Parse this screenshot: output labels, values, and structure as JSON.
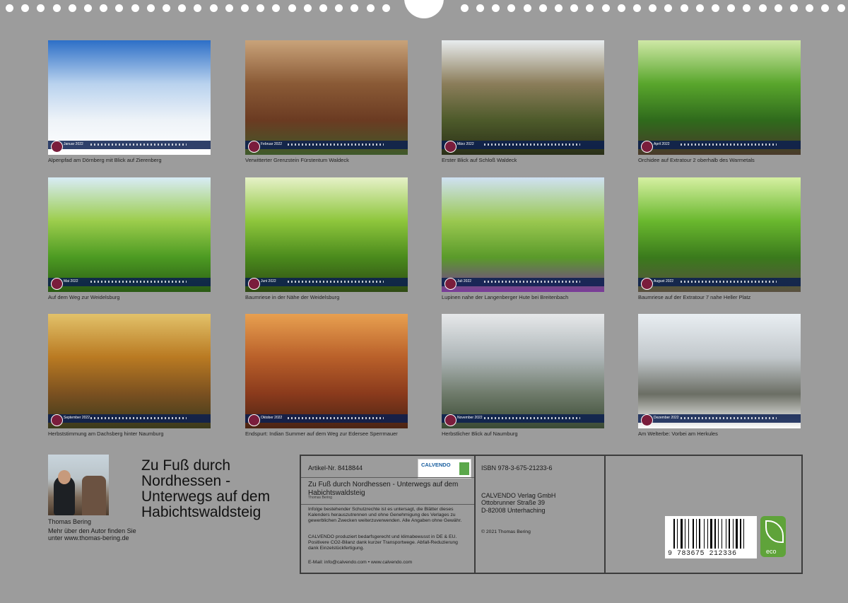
{
  "calendar": {
    "tiles": [
      {
        "caption": "Alpenpfad am Dörnberg mit Blick auf Zierenberg",
        "month_label": "Januar 2022",
        "palette": [
          "#2d6fc7",
          "#b9d2ee",
          "#eef3f8",
          "#ffffff"
        ]
      },
      {
        "caption": "Verwitterter Grenzstein Fürstentum Waldeck",
        "month_label": "Februar 2022",
        "palette": [
          "#c9a37a",
          "#8a5a36",
          "#6b3b22",
          "#3f5a2a"
        ]
      },
      {
        "caption": "Erster Blick auf Schloß Waldeck",
        "month_label": "März 2022",
        "palette": [
          "#e8ecee",
          "#8b7d5a",
          "#4d5a2a",
          "#2a2f18"
        ]
      },
      {
        "caption": "Orchidee auf Extratour 2 oberhalb des Warmetals",
        "month_label": "April 2022",
        "palette": [
          "#cfe8a6",
          "#59a62c",
          "#2f6a1c",
          "#4a3a2a"
        ]
      },
      {
        "caption": "Auf dem Weg zur Weidelsburg",
        "month_label": "Mai 2022",
        "palette": [
          "#d8ecf6",
          "#9ccd4c",
          "#4c9a22",
          "#2a5a14"
        ]
      },
      {
        "caption": "Baumriese in der Nähe der Weidelsburg",
        "month_label": "Juni 2022",
        "palette": [
          "#e6f1c8",
          "#8ec63c",
          "#4a8a1c",
          "#2f4a14"
        ]
      },
      {
        "caption": "Lupinen nahe der Langenberger Hute bei Breitenbach",
        "month_label": "Juli 2022",
        "palette": [
          "#cfe1f2",
          "#9ac850",
          "#5a9a2a",
          "#7a3a9a"
        ]
      },
      {
        "caption": "Baumriese auf der Extratour 7 nahe Heller Platz",
        "month_label": "August 2022",
        "palette": [
          "#d6f0a2",
          "#6ab82e",
          "#3a7a1c",
          "#5a5040"
        ]
      },
      {
        "caption": "Herbststimmung am Dachsberg hinter Naumburg",
        "month_label": "September 2022",
        "palette": [
          "#e2c26a",
          "#b97a22",
          "#7a5020",
          "#3a3a1c"
        ]
      },
      {
        "caption": "Endspurt: Indian Summer auf dem Weg zur Edersee Sperrmauer",
        "month_label": "Oktober 2022",
        "palette": [
          "#e8a050",
          "#b9602a",
          "#8a3a1c",
          "#4a2414"
        ]
      },
      {
        "caption": "Herbstlicher Blick auf Naumburg",
        "month_label": "November 2022",
        "palette": [
          "#e6e8ea",
          "#aeb6b8",
          "#6e7a6a",
          "#3a4a34"
        ]
      },
      {
        "caption": "Am Welterbe: Vorbei am Herkules",
        "month_label": "Dezember 2022",
        "palette": [
          "#e9eef2",
          "#c2c8cc",
          "#6b6e64",
          "#ffffff"
        ]
      }
    ]
  },
  "author": {
    "name": "Thomas Bering",
    "more": "Mehr über den Autor finden Sie unter www.thomas-bering.de"
  },
  "title": "Zu Fuß durch Nordhessen - Unterwegs auf dem Habichtswaldsteig",
  "box": {
    "artikel": "Artikel-Nr. 8418844",
    "logo_text": "CALVENDO",
    "title": "Zu Fuß durch Nordhessen - Unterwegs auf dem Habichtswaldsteig",
    "author": "Thomas Bering",
    "legal1": "Infolge bestehender Schutzrechte ist es untersagt, die Blätter dieses Kalenders herauszutrennen und ohne Genehmigung des Verlages zu gewerblichen Zwecken weiterzuverwenden. Alle Angaben ohne Gewähr.",
    "legal2": "CALVENDO produziert bedarfsgerecht und klimabewusst in DE & EU. Positivere CO2-Bilanz dank kurzer Transportwege. Abfall-Reduzierung dank Einzelstückfertigung.",
    "contact": "E-Mail: info@calvendo.com • www.calvendo.com",
    "isbn": "ISBN 978-3-675-21233-6",
    "publisher": [
      "CALVENDO Verlag GmbH",
      "Ottobrunner Straße 39",
      "D-82008 Unterhaching"
    ],
    "copyright": "© 2021 Thomas Bering",
    "barcode_number": "9 783675 212336",
    "eco_label": "eco"
  }
}
